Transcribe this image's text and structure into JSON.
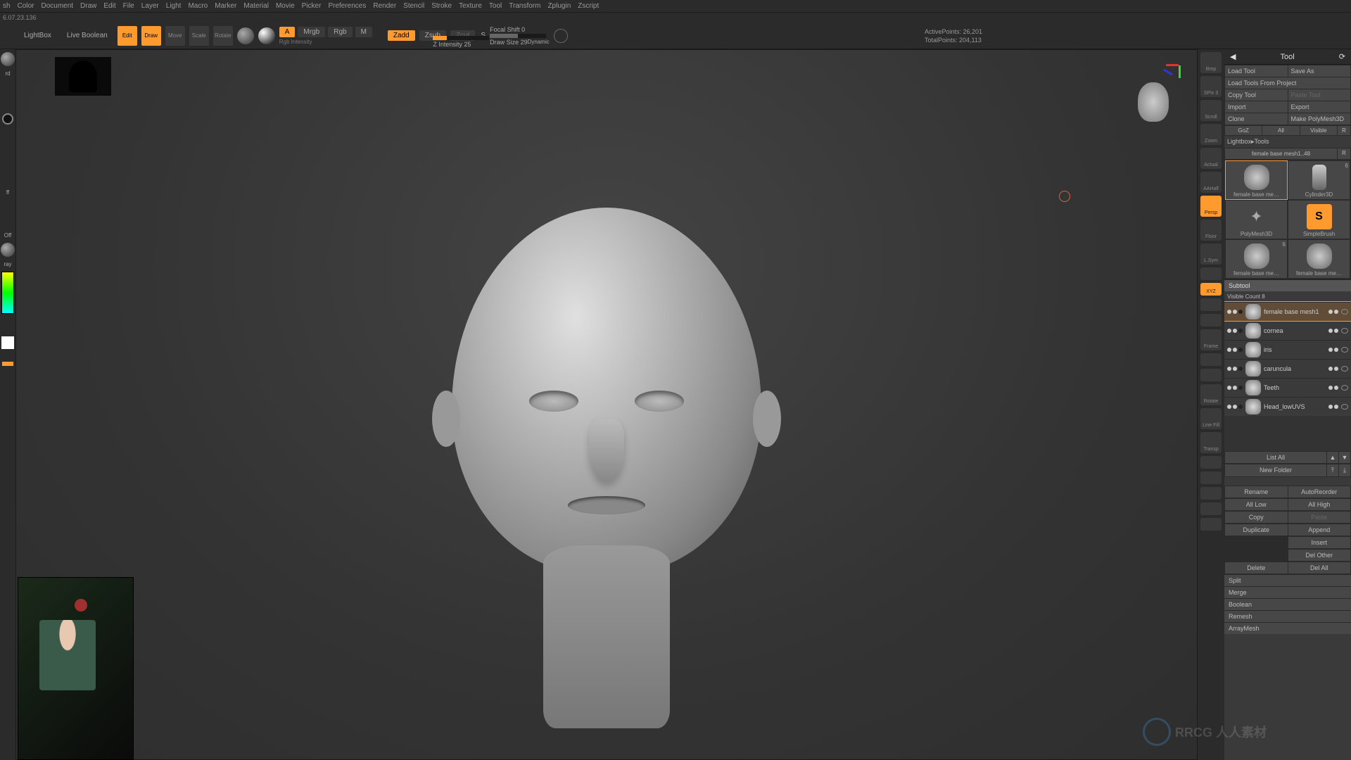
{
  "version": "6.07.23.136",
  "menu": [
    "sh",
    "Color",
    "Document",
    "Draw",
    "Edit",
    "File",
    "Layer",
    "Light",
    "Macro",
    "Marker",
    "Material",
    "Movie",
    "Picker",
    "Preferences",
    "Render",
    "Stencil",
    "Stroke",
    "Texture",
    "Tool",
    "Transform",
    "Zplugin",
    "Zscript"
  ],
  "topbar": {
    "lightbox": "LightBox",
    "liveboolean": "Live Boolean",
    "edit": "Edit",
    "draw": "Draw",
    "move": "Move",
    "scale": "Scale",
    "rotate": "Rotate",
    "a_toggle": "A",
    "mrgb": "Mrgb",
    "rgb": "Rgb",
    "m": "M",
    "rgb_intensity": "Rgb Intensity",
    "zadd": "Zadd",
    "zsub": "Zsub",
    "zcut": "Zcut",
    "z_intensity": "Z Intensity 25",
    "focal_shift": "Focal Shift 0",
    "draw_size": "Draw Size 29",
    "dynamic": "Dynamic",
    "s_char": "S",
    "active_points": "ActivePoints: 26,201",
    "total_points": "TotalPoints: 204,113"
  },
  "shelf": [
    "Bmp",
    "SPix 3",
    "Scroll",
    "Zoom",
    "Actual",
    "AAHalf",
    "Persp",
    "Floor",
    "L.Sym",
    "",
    "XYZ",
    "",
    "",
    "Frame",
    "",
    "",
    "Rotate",
    "Line Fill",
    "Transp",
    "",
    "",
    "",
    "",
    ""
  ],
  "shelf_active_index": 6,
  "shelf_xyz_index": 10,
  "toolpanel": {
    "title": "Tool",
    "load_tool": "Load Tool",
    "save_as": "Save As",
    "load_project": "Load Tools From Project",
    "copy_tool": "Copy Tool",
    "paste_tool": "Paste Tool",
    "import": "Import",
    "export": "Export",
    "clone": "Clone",
    "make_polymesh": "Make PolyMesh3D",
    "goz": "GoZ",
    "all": "All",
    "visible": "Visible",
    "r": "R",
    "lightbox_tools": "Lightbox▸Tools",
    "mesh_label": "female base mesh1..48",
    "thumbs": [
      {
        "name": "female base me…"
      },
      {
        "name": "Cylinder3D"
      },
      {
        "name": "PolyMesh3D"
      },
      {
        "name": "SimpleBrush"
      },
      {
        "name": "female base me…"
      },
      {
        "name": "female base me…"
      }
    ]
  },
  "subtool": {
    "title": "Subtool",
    "visible_count": "Visible Count 8",
    "items": [
      {
        "name": "female base mesh1",
        "sel": true
      },
      {
        "name": "cornea"
      },
      {
        "name": "iris"
      },
      {
        "name": "caruncula"
      },
      {
        "name": "Teeth"
      },
      {
        "name": "Head_lowUVS"
      }
    ],
    "list_all": "List All",
    "new_folder": "New Folder",
    "rename": "Rename",
    "autoreorder": "AutoReorder",
    "all_low": "All Low",
    "all_high": "All High",
    "copy": "Copy",
    "paste": "Paste",
    "duplicate": "Duplicate",
    "append": "Append",
    "insert": "Insert",
    "del_other": "Del Other",
    "delete": "Delete",
    "del_all": "Del All",
    "split": "Split",
    "merge": "Merge",
    "boolean": "Boolean",
    "remesh": "Remesh",
    "arraymesh": "ArrayMesh"
  },
  "watermark": "RRCG 人人素材"
}
